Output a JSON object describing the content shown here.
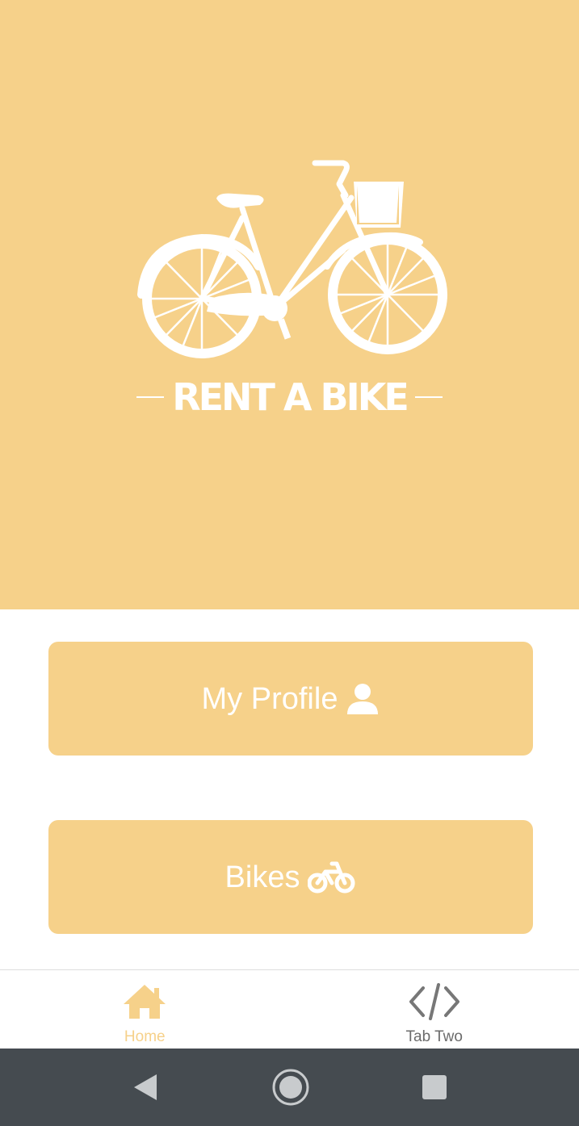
{
  "hero": {
    "brand_text": "RENT A BIKE",
    "logo_icon": "bicycle-with-basket-icon",
    "background_color": "#F6D18A"
  },
  "menu": {
    "profile_label": "My Profile",
    "profile_icon": "person-icon",
    "bikes_label": "Bikes",
    "bikes_icon": "bike-icon",
    "button_color": "#F6D18A"
  },
  "tabs": [
    {
      "label": "Home",
      "icon": "home-icon",
      "active": true
    },
    {
      "label": "Tab Two",
      "icon": "code-icon",
      "active": false
    }
  ],
  "colors": {
    "accent": "#F6D18A",
    "inactive_tab": "#6b6b6b",
    "system_nav": "#454B50"
  },
  "system_nav": {
    "back_icon": "back-triangle-icon",
    "home_icon": "home-circle-icon",
    "recents_icon": "recents-square-icon"
  }
}
